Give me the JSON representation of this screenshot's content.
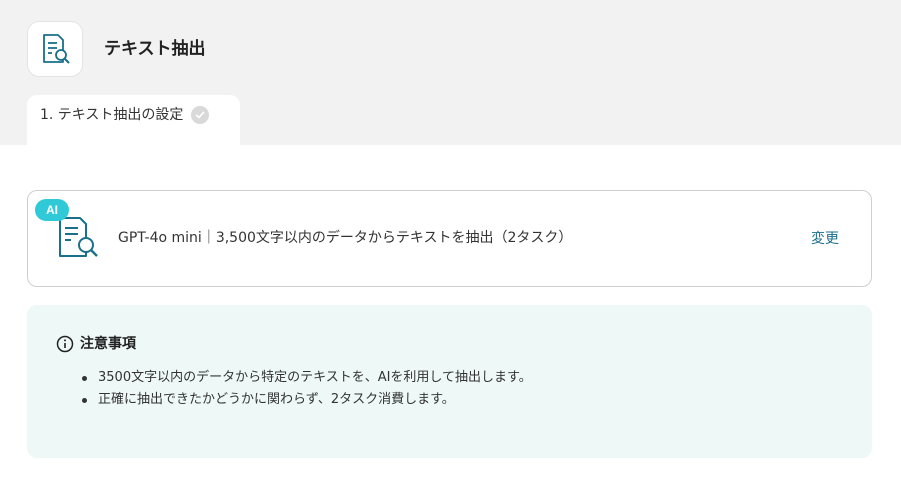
{
  "header": {
    "title": "テキスト抽出",
    "icon": "document-search-icon"
  },
  "steps": [
    {
      "label": "1. テキスト抽出の設定",
      "status": "complete",
      "icon": "check-circle-icon"
    }
  ],
  "action_card": {
    "badge": "AI",
    "icon": "document-search-icon",
    "description": "GPT-4o mini｜3,500文字以内のデータからテキストを抽出（2タスク）",
    "change_label": "変更"
  },
  "notice": {
    "icon": "info-icon",
    "title": "注意事項",
    "items": [
      "3500文字以内のデータから特定のテキストを、AIを利用して抽出します。",
      "正確に抽出できたかどうかに関わらず、2タスク消費します。"
    ]
  },
  "colors": {
    "accent": "#1a6f8a",
    "badge": "#30c9d8",
    "notice_bg": "#eef8f7",
    "top_bg": "#f2f2f2"
  }
}
